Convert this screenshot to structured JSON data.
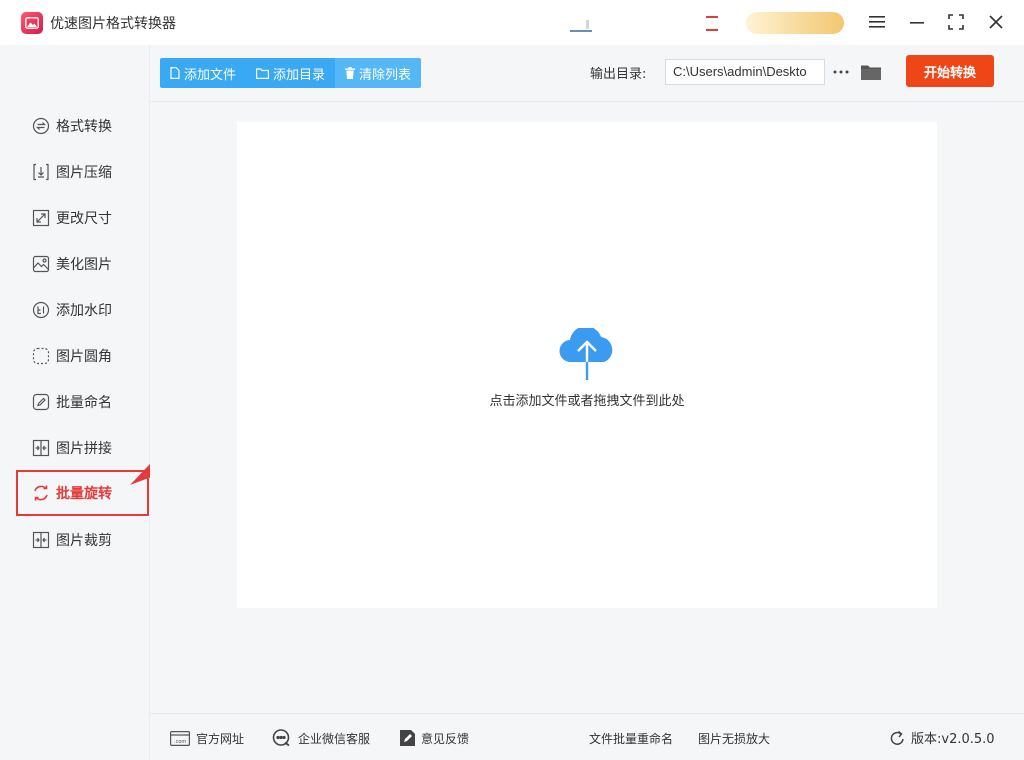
{
  "app": {
    "title": "优速图片格式转换器"
  },
  "sidebar": {
    "items": [
      {
        "label": "格式转换",
        "icon": "convert-icon"
      },
      {
        "label": "图片压缩",
        "icon": "compress-icon"
      },
      {
        "label": "更改尺寸",
        "icon": "resize-icon"
      },
      {
        "label": "美化图片",
        "icon": "beautify-icon"
      },
      {
        "label": "添加水印",
        "icon": "watermark-icon"
      },
      {
        "label": "图片圆角",
        "icon": "round-corner-icon"
      },
      {
        "label": "批量命名",
        "icon": "rename-icon"
      },
      {
        "label": "图片拼接",
        "icon": "splice-icon"
      },
      {
        "label": "批量旋转",
        "icon": "rotate-icon",
        "active": true
      },
      {
        "label": "图片裁剪",
        "icon": "crop-icon"
      }
    ]
  },
  "toolbar": {
    "add_file": "添加文件",
    "add_folder": "添加目录",
    "clear_list": "清除列表",
    "output_label": "输出目录:",
    "output_path": "C:\\Users\\admin\\Deskto",
    "more": "···",
    "start": "开始转换"
  },
  "main": {
    "drop_hint": "点击添加文件或者拖拽文件到此处"
  },
  "footer": {
    "website": "官方网址",
    "wechat": "企业微信客服",
    "feedback": "意见反馈",
    "batch_rename": "文件批量重命名",
    "lossless_zoom": "图片无损放大",
    "version": "版本:v2.0.5.0"
  },
  "colors": {
    "accent_blue": "#39a9f3",
    "start_orange": "#ee4616",
    "active_red": "#e63a3a",
    "cloud_blue": "#3a9bf0"
  }
}
